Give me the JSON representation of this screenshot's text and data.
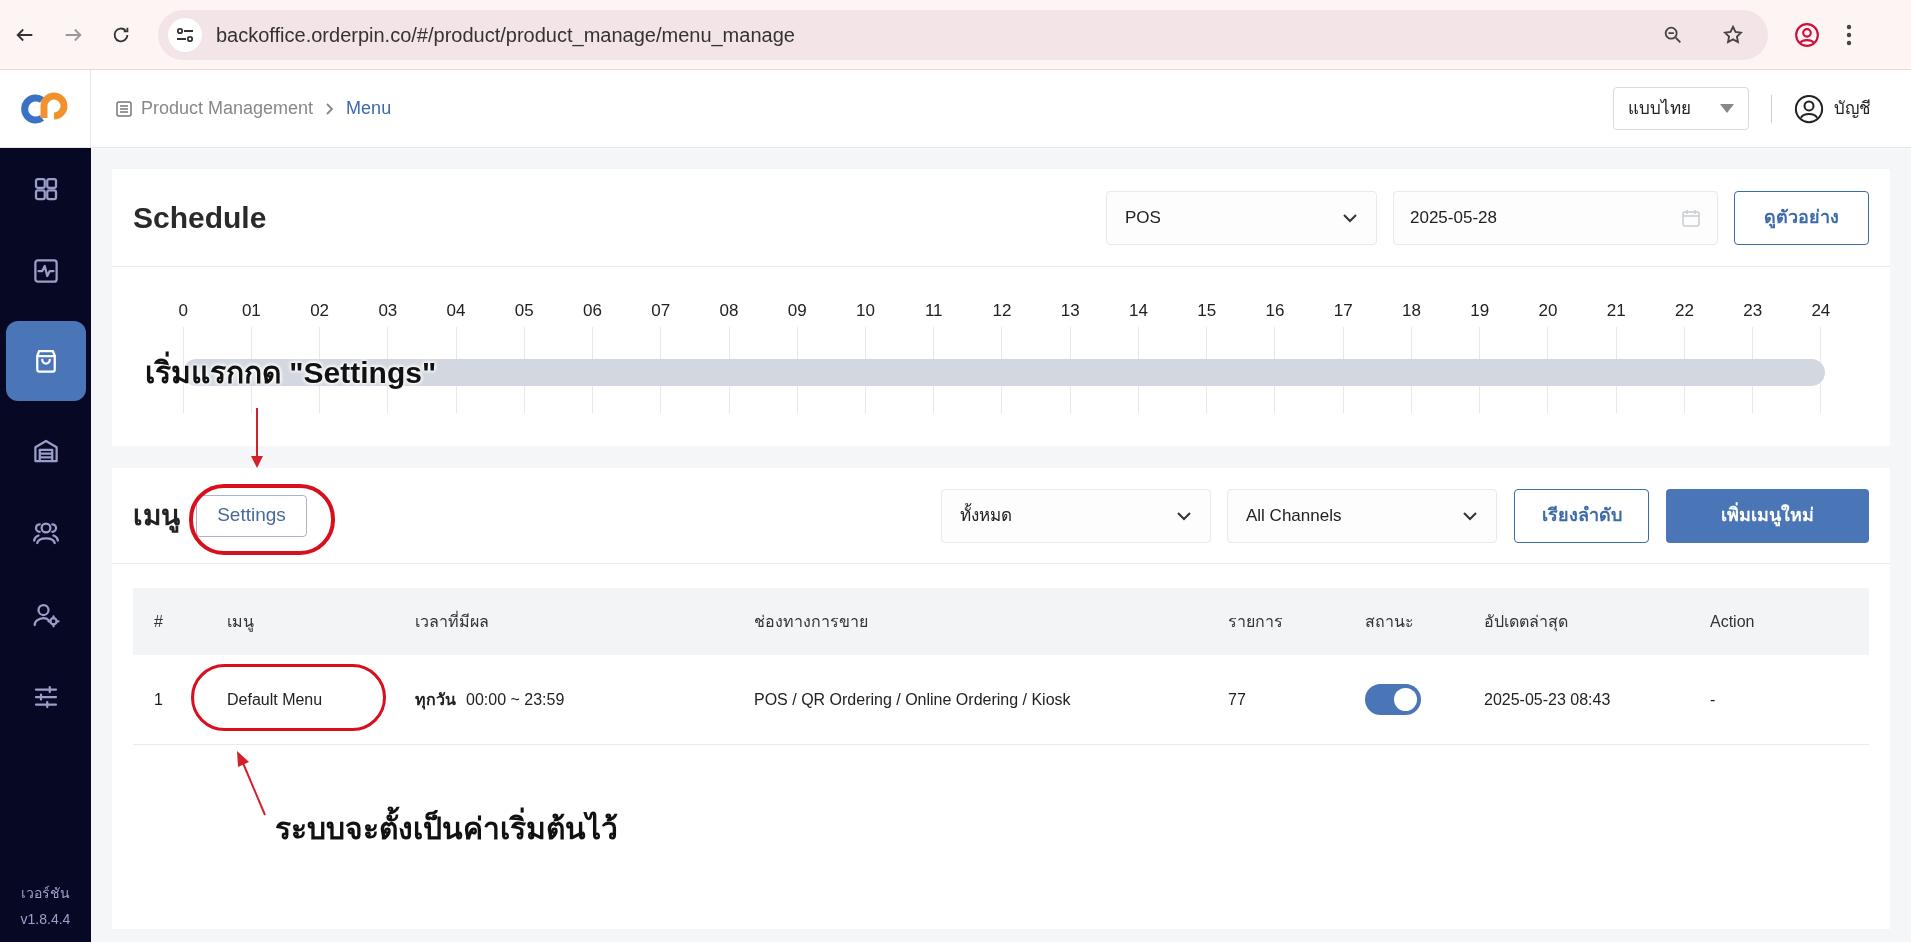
{
  "browser": {
    "url": "backoffice.orderpin.co/#/product/product_manage/menu_manage"
  },
  "header": {
    "breadcrumb": [
      {
        "label": "Product Management",
        "current": false
      },
      {
        "label": "Menu",
        "current": true
      }
    ],
    "language": "แบบไทย",
    "account": "บัญชี"
  },
  "sidebar": {
    "items": [
      {
        "kind": "dashboard",
        "selected": false
      },
      {
        "kind": "activity",
        "selected": false
      },
      {
        "kind": "bag",
        "selected": true
      },
      {
        "kind": "storage",
        "selected": false
      },
      {
        "kind": "people",
        "selected": false
      },
      {
        "kind": "user-settings",
        "selected": false
      },
      {
        "kind": "sliders",
        "selected": false
      }
    ],
    "version_label": "เวอร์ชัน",
    "version": "v1.8.4.4"
  },
  "schedule": {
    "title": "Schedule",
    "channel": "POS",
    "date": "2025-05-28",
    "preview_button": "ดูตัวอย่าง",
    "hours": [
      "0",
      "01",
      "02",
      "03",
      "04",
      "05",
      "06",
      "07",
      "08",
      "09",
      "10",
      "11",
      "12",
      "13",
      "14",
      "15",
      "16",
      "17",
      "18",
      "19",
      "20",
      "21",
      "22",
      "23",
      "24"
    ]
  },
  "menu": {
    "title": "เมนู",
    "settings_button": "Settings",
    "filter": "ทั้งหมด",
    "channel_filter": "All Channels",
    "sort_button": "เรียงลำดับ",
    "add_button": "เพิ่มเมนูใหม่",
    "table": {
      "columns": [
        "#",
        "เมนู",
        "เวลาที่มีผล",
        "ช่องทางการขาย",
        "รายการ",
        "สถานะ",
        "อัปเดตล่าสุด",
        "Action"
      ],
      "rows": [
        {
          "index": "1",
          "name": "Default Menu",
          "days": "ทุกวัน",
          "time": "00:00 ~ 23:59",
          "channels": "POS / QR Ordering / Online Ordering / Kiosk",
          "items": "77",
          "on": true,
          "updated": "2025-05-23 08:43",
          "action": "-"
        }
      ]
    }
  },
  "annotations": [
    {
      "text": "เริ่มแรกกด \"Settings\""
    },
    {
      "text": "ระบบจะตั้งเป็นค่าเริ่มต้นไว้"
    }
  ]
}
